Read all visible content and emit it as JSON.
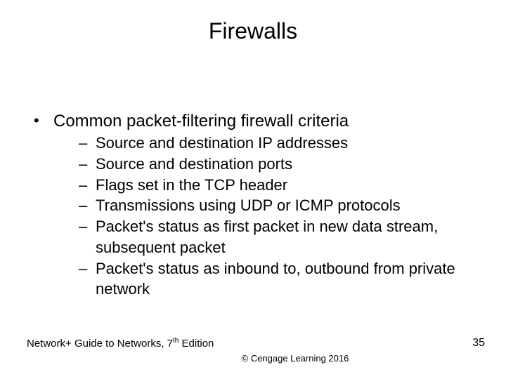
{
  "title": "Firewalls",
  "main_bullet": "Common packet-filtering firewall criteria",
  "sub_bullets": [
    "Source and destination IP addresses",
    "Source and destination ports",
    "Flags set in the TCP header",
    "Transmissions using UDP or ICMP protocols",
    "Packet's status as first packet in new data stream, subsequent packet",
    "Packet's status as inbound to, outbound from private network"
  ],
  "footer": {
    "left_pre": "Network+ Guide to Networks, 7",
    "left_sup": "th",
    "left_post": " Edition",
    "copyright": "© Cengage Learning  2016",
    "page": "35"
  }
}
